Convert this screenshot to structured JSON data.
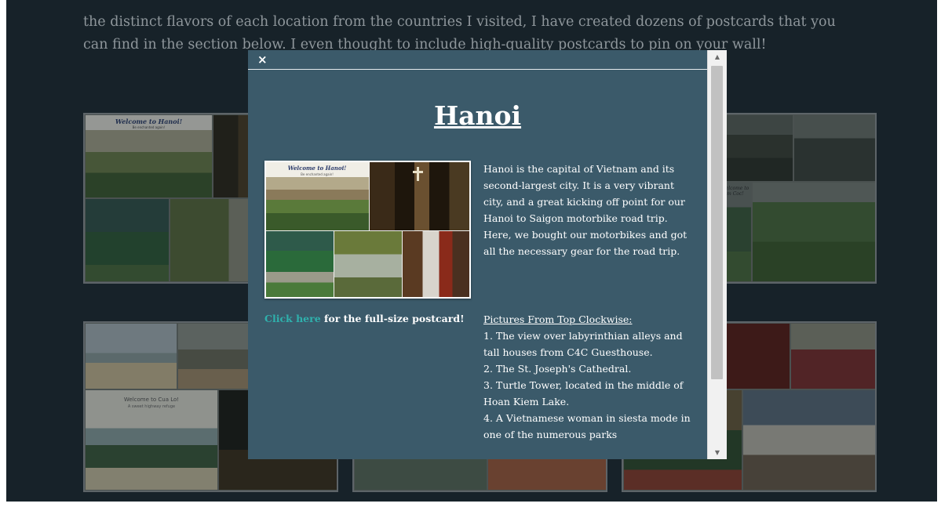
{
  "page": {
    "intro_line1": "the distinct flavors of each location from the countries I visited, I have created dozens of postcards that you",
    "intro_line2": "can find in the section below. I even thought to include high-quality postcards to pin on your wall!"
  },
  "gallery": {
    "thumbs": [
      {
        "name": "postcard-thumb-hanoi",
        "title": "Welcome to Hanoi!",
        "subtitle": "Be enchanted again!"
      },
      {
        "name": "postcard-thumb-ninh-binh",
        "title": "Welcome to Tam Coc!"
      },
      {
        "name": "postcard-thumb-cua-lo",
        "title": "Welcome to Cua Lo!",
        "subtitle": "A sweet highway refuge"
      },
      {
        "name": "postcard-thumb-middle-bottom"
      },
      {
        "name": "postcard-thumb-hue"
      }
    ]
  },
  "modal": {
    "close_label": "×",
    "title": "Hanoi",
    "postcard": {
      "title": "Welcome to Hanoi!",
      "subtitle": "Be enchanted again!"
    },
    "description": "Hanoi is the capital of Vietnam and its second-largest city. It is a very vibrant city, and a great kicking off point for our Hanoi to Saigon motorbike road trip. Here, we bought our motorbikes and got all the necessary gear for the road trip.",
    "link_text": "Click here",
    "link_suffix": " for the full-size postcard!",
    "pictures_heading": "Pictures From Top Clockwise:",
    "pictures": [
      "1. The view over labyrinthian alleys and tall houses from C4C Guesthouse.",
      "2. The St. Joseph's Cathedral.",
      "3. Turtle Tower, located in the middle of Hoan Kiem Lake.",
      "4. A Vietnamese woman in siesta mode in one of the numerous parks"
    ]
  },
  "scrollbar": {
    "up_arrow": "▲",
    "down_arrow": "▼"
  },
  "colors": {
    "page_background": "#172229",
    "modal_background": "#3b5a6a",
    "link": "#2fb1ad",
    "intro_text": "#8e969b"
  }
}
